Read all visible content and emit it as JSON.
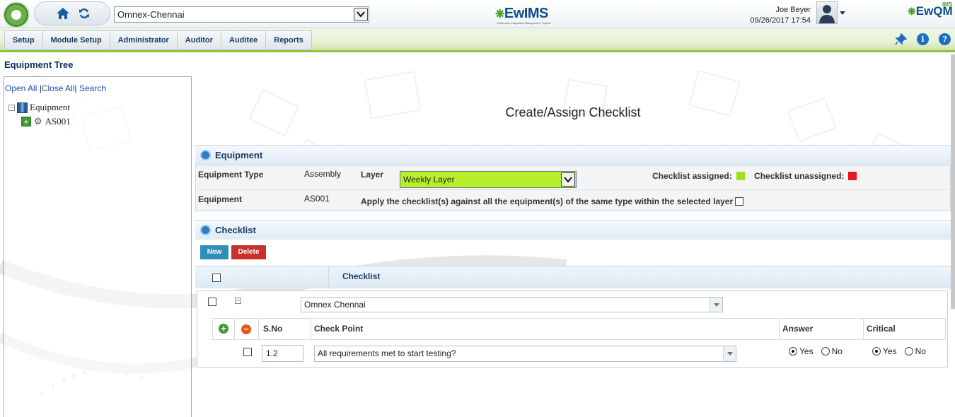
{
  "header": {
    "site_select_value": "Omnex-Chennai",
    "brand_center": "EwIMS",
    "brand_center_tagline": "Enterprise Integrated Management System",
    "user_name": "Joe Beyer",
    "datetime": "09/26/2017 17:54",
    "brand_right": "EwQM",
    "brand_right_sup": "IMS"
  },
  "menu": {
    "items": [
      "Setup",
      "Module Setup",
      "Administrator",
      "Auditor",
      "Auditee",
      "Reports"
    ],
    "icons": [
      "pin-icon",
      "info-icon",
      "help-icon"
    ]
  },
  "tree": {
    "title": "Equipment Tree",
    "links": {
      "open_all": "Open All",
      "close_all": "Close All",
      "search": "Search"
    },
    "nodes": [
      {
        "label": "Equipment",
        "icon": "equipment-folder-icon"
      },
      {
        "label": "AS001",
        "icon": "gear-icon"
      }
    ]
  },
  "main": {
    "title": "Create/Assign Checklist",
    "equipment_section": {
      "header": "Equipment",
      "equipment_type_label": "Equipment Type",
      "equipment_type_value": "Assembly",
      "layer_label": "Layer",
      "layer_value": "Weekly Layer",
      "assigned_label": "Checklist assigned:",
      "unassigned_label": "Checklist unassigned:",
      "assigned_color": "#9fe01e",
      "unassigned_color": "#e8151b",
      "equipment_label": "Equipment",
      "equipment_value": "AS001",
      "apply_label": "Apply the checklist(s) against all the equipment(s) of the same type within the selected layer"
    },
    "checklist_section": {
      "header": "Checklist",
      "new_button": "New",
      "delete_button": "Delete",
      "column_checklist": "Checklist",
      "group_value": "Omnex Chennai",
      "columns": {
        "sno": "S.No",
        "check_point": "Check Point",
        "answer": "Answer",
        "critical": "Critical"
      },
      "rows": [
        {
          "sno": "1.2",
          "check_point": "All requirements met to start testing?",
          "answer_options": [
            "Yes",
            "No"
          ],
          "answer_selected": "Yes",
          "critical_options": [
            "Yes",
            "No"
          ],
          "critical_selected": "Yes"
        }
      ]
    }
  },
  "colors": {
    "accent_green": "#8cc43f",
    "new_button": "#2f8fb8",
    "delete_button": "#c8302a",
    "nav_text": "#1a3c6b"
  }
}
